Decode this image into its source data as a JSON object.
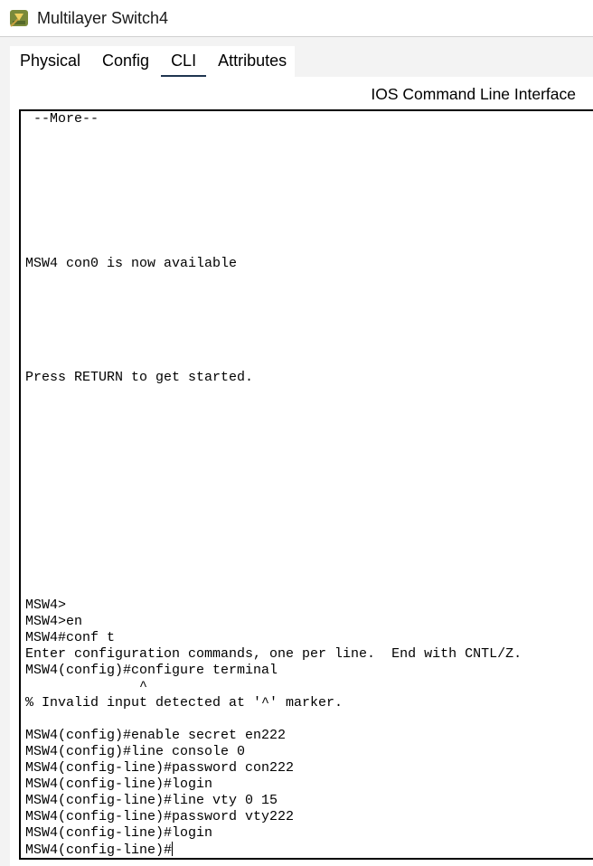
{
  "window": {
    "title": "Multilayer Switch4"
  },
  "tabs": [
    {
      "label": "Physical",
      "active": false
    },
    {
      "label": "Config",
      "active": false
    },
    {
      "label": "CLI",
      "active": true
    },
    {
      "label": "Attributes",
      "active": false
    }
  ],
  "cli": {
    "header": "IOS Command Line Interface",
    "lines": {
      "more": " --More--",
      "con0": "MSW4 con0 is now available",
      "press_return": "Press RETURN to get started.",
      "l1": "MSW4>",
      "l2": "MSW4>en",
      "l3": "MSW4#conf t",
      "l4": "Enter configuration commands, one per line.  End with CNTL/Z.",
      "l5": "MSW4(config)#configure terminal",
      "l6": "              ^",
      "l7": "% Invalid input detected at '^' marker.",
      "l8": "MSW4(config)#enable secret en222",
      "l9": "MSW4(config)#line console 0",
      "l10": "MSW4(config-line)#password con222",
      "l11": "MSW4(config-line)#login",
      "l12": "MSW4(config-line)#line vty 0 15",
      "l13": "MSW4(config-line)#password vty222",
      "l14": "MSW4(config-line)#login",
      "l15": "MSW4(config-line)#"
    }
  }
}
